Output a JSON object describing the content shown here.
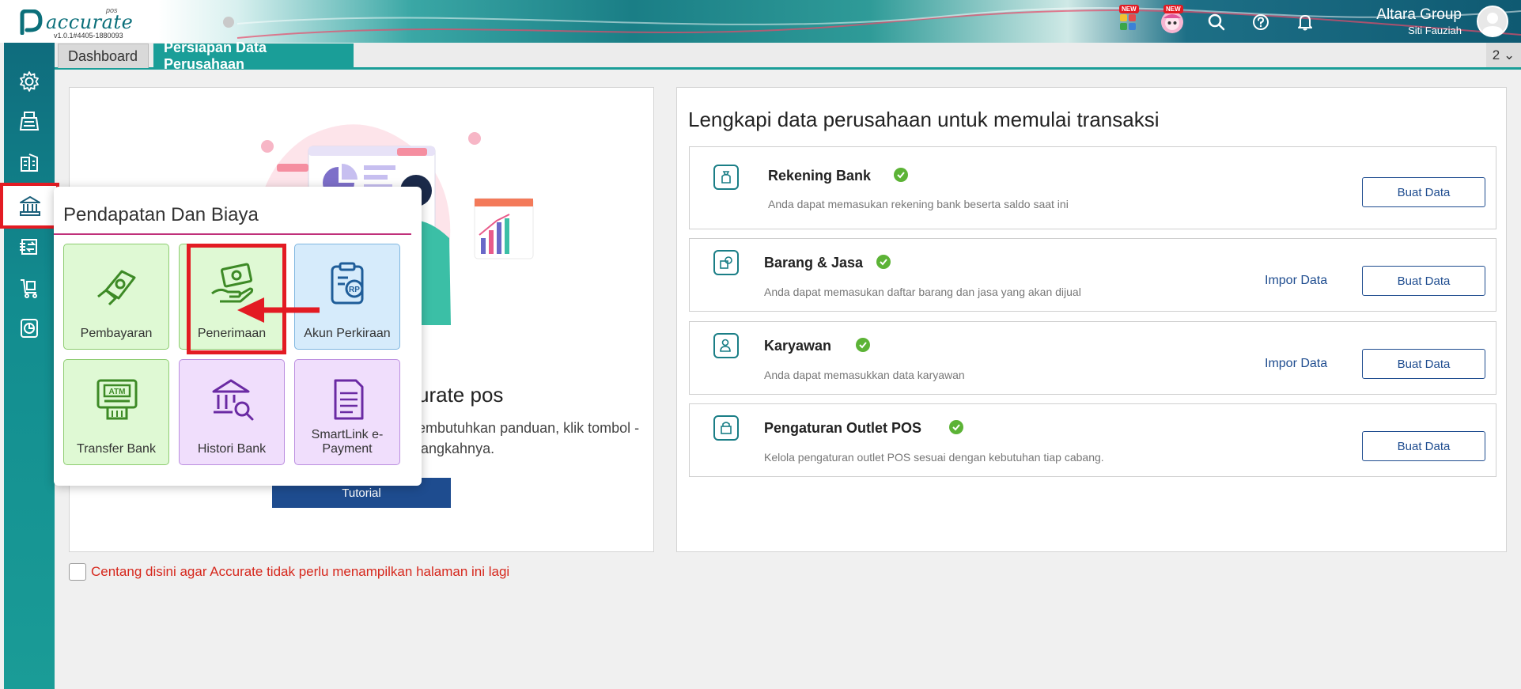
{
  "app": {
    "logo_text": "accurate",
    "logo_sub": "pos",
    "version": "v1.0.1#4405-1880093",
    "company_name": "Altara Group",
    "user_name": "Siti Fauziah",
    "new_badge": "NEW"
  },
  "tabs": {
    "dashboard": "Dashboard",
    "active": "Persiapan Data Perusahaan",
    "more": "2 ⌄"
  },
  "hero": {
    "title": "urate pos",
    "desc": "embutuhkan panduan, klik tombol -langkahnya.",
    "tutorial_button": "Tutorial"
  },
  "right": {
    "title": "Lengkapi data perusahaan untuk memulai transaksi",
    "tasks": [
      {
        "name": "Rekening Bank",
        "desc": "Anda dapat memasukan rekening bank beserta saldo saat ini",
        "button": "Buat Data"
      },
      {
        "name": "Barang & Jasa",
        "desc": "Anda dapat memasukan daftar barang dan jasa yang akan dijual",
        "button": "Buat Data",
        "link": "Impor Data"
      },
      {
        "name": "Karyawan",
        "desc": "Anda dapat memasukkan data karyawan",
        "button": "Buat Data",
        "link": "Impor Data"
      },
      {
        "name": "Pengaturan Outlet POS",
        "desc": "Kelola pengaturan outlet POS sesuai dengan kebutuhan tiap cabang.",
        "button": "Buat Data"
      }
    ]
  },
  "footer": {
    "checkbox_label": "Centang disini agar Accurate tidak perlu menampilkan halaman ini lagi"
  },
  "popup": {
    "title": "Pendapatan Dan Biaya",
    "tiles": [
      {
        "label": "Pembayaran",
        "icon": "hand-money-icon"
      },
      {
        "label": "Penerimaan",
        "icon": "receive-money-icon"
      },
      {
        "label": "Akun Perkiraan",
        "icon": "account-rp-icon"
      },
      {
        "label": "Transfer Bank",
        "icon": "atm-icon"
      },
      {
        "label": "Histori Bank",
        "icon": "bank-history-icon"
      },
      {
        "label": "SmartLink e-Payment",
        "icon": "e-payment-icon"
      }
    ]
  },
  "colors": {
    "teal": "#1a9e98",
    "navy": "#1e4c8f",
    "highlight_red": "#e31b23",
    "check_green": "#5cb336"
  }
}
